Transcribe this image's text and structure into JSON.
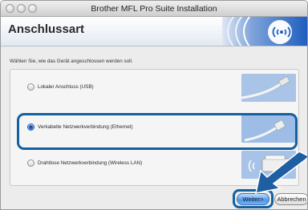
{
  "window": {
    "title": "Brother MFL Pro Suite Installation"
  },
  "header": {
    "title": "Anschlussart"
  },
  "instruction": "Wählen Sie, wie das Gerät angeschlossen werden soll.",
  "options": [
    {
      "label": "Lokaler Anschluss (USB)",
      "selected": false,
      "image": "usb-cable-icon"
    },
    {
      "label": "Verkabelte Netzwerkverbindung (Ethernet)",
      "selected": true,
      "image": "ethernet-cable-icon"
    },
    {
      "label": "Drahtlose Netzwerkverbindung (Wireless LAN)",
      "selected": false,
      "image": "wireless-printer-icon"
    }
  ],
  "buttons": {
    "next": "Weiter>",
    "cancel": "Abbrechen"
  },
  "colors": {
    "highlight": "#15609f",
    "header_logo": "#1f5fbf"
  }
}
